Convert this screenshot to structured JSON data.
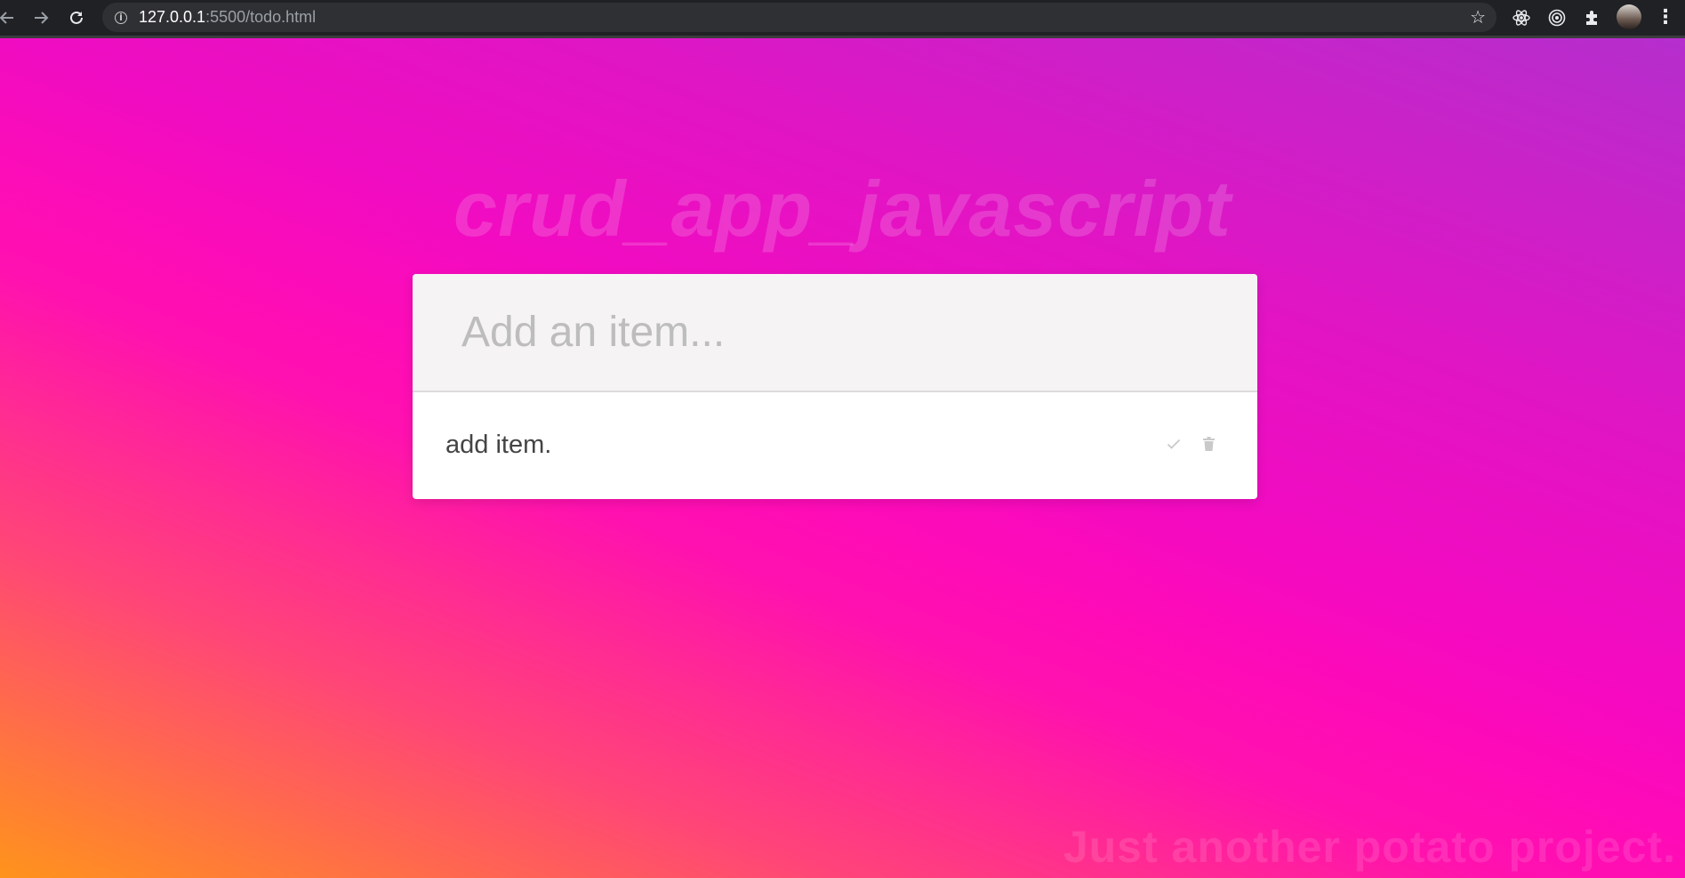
{
  "browser": {
    "url_host": "127.0.0.1",
    "url_path": ":5500/todo.html",
    "icons": [
      "back-icon",
      "forward-icon",
      "reload-icon",
      "info-icon",
      "star-icon",
      "react-devtools-icon",
      "target-extension-icon",
      "extensions-puzzle-icon",
      "avatar",
      "menu-icon"
    ]
  },
  "app": {
    "title": "crud_app_javascript",
    "input": {
      "placeholder": "Add an item...",
      "value": ""
    },
    "items": [
      {
        "text": "add item."
      }
    ],
    "footer": "Just another potato project."
  },
  "colors": {
    "gradient_top_right": "#b52ecd",
    "gradient_middle": "#ff04bf",
    "gradient_bottom_left": "#ff9b14",
    "card": "#ffffff",
    "input_bg": "#f5f3f4"
  }
}
